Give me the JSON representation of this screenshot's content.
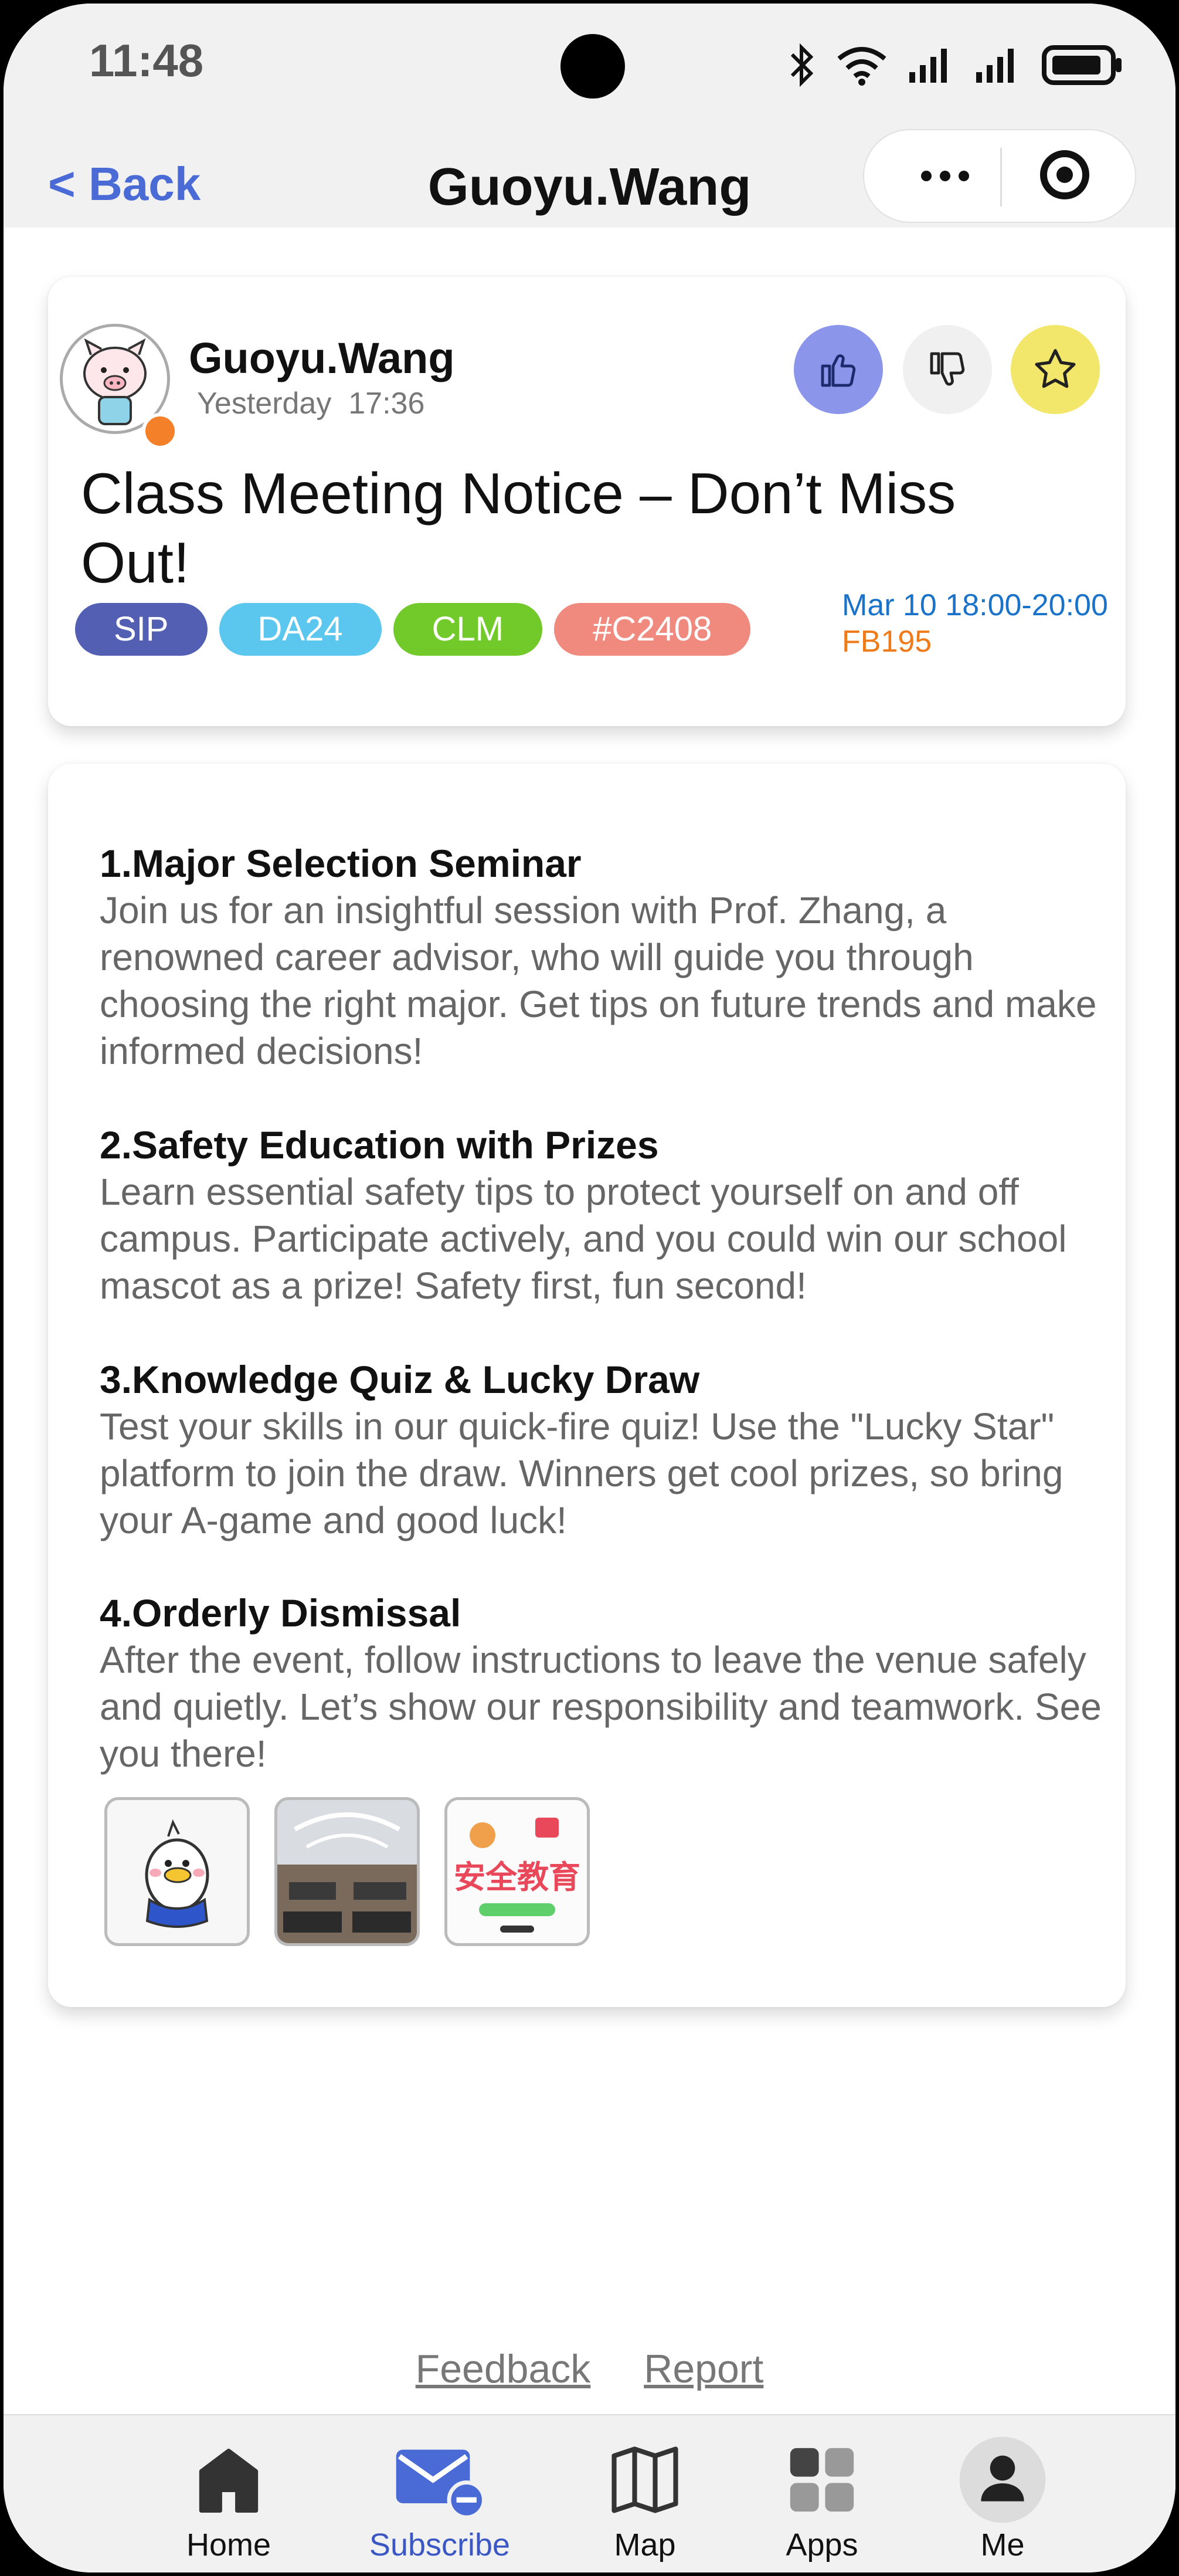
{
  "status_bar": {
    "time": "11:48"
  },
  "nav": {
    "back_label": "< Back",
    "title": "Guoyu.Wang"
  },
  "post": {
    "author": "Guoyu.Wang",
    "posted_day": "Yesterday",
    "posted_time": "17:36",
    "title": "Class Meeting Notice – Don’t Miss Out!",
    "tags": [
      {
        "label": "SIP",
        "color": "#535fb3"
      },
      {
        "label": "DA24",
        "color": "#5bc7ee"
      },
      {
        "label": "CLM",
        "color": "#72c92a"
      },
      {
        "label": "#C2408",
        "color": "#f08a7e"
      }
    ],
    "event_time": "Mar 10 18:00-20:00",
    "event_location": "FB195",
    "reactions": {
      "like": "thumbs-up-icon",
      "dislike": "thumbs-down-icon",
      "favorite": "star-icon"
    }
  },
  "content": {
    "sections": [
      {
        "title": "1.Major Selection Seminar",
        "body": "Join us for an insightful session with Prof. Zhang, a renowned career advisor, who will guide you through choosing the right major. Get tips on future trends and make informed decisions!"
      },
      {
        "title": "2.Safety Education with Prizes",
        "body": "Learn essential safety tips to protect yourself on and off campus. Participate actively, and you could win our school mascot as a prize! Safety first, fun second!"
      },
      {
        "title": "3.Knowledge Quiz & Lucky Draw",
        "body": "Test your skills in our quick-fire quiz! Use the \"Lucky Star\" platform to join the draw. Winners get cool prizes, so bring your A-game and good luck!"
      },
      {
        "title": "4.Orderly Dismissal",
        "body": "After the event, follow instructions to leave the venue safely and quietly. Let’s show our responsibility and teamwork. See you there!"
      }
    ],
    "images": [
      {
        "name": "mascot-thumbnail"
      },
      {
        "name": "meeting-room-thumbnail"
      },
      {
        "name": "safety-education-thumbnail",
        "text": "安全教育"
      }
    ]
  },
  "footer": {
    "feedback": "Feedback",
    "report": "Report"
  },
  "tabbar": {
    "items": [
      {
        "label": "Home",
        "icon": "home-icon"
      },
      {
        "label": "Subscribe",
        "icon": "mail-icon",
        "active": true
      },
      {
        "label": "Map",
        "icon": "map-icon"
      },
      {
        "label": "Apps",
        "icon": "apps-icon"
      },
      {
        "label": "Me",
        "icon": "user-icon"
      }
    ]
  }
}
